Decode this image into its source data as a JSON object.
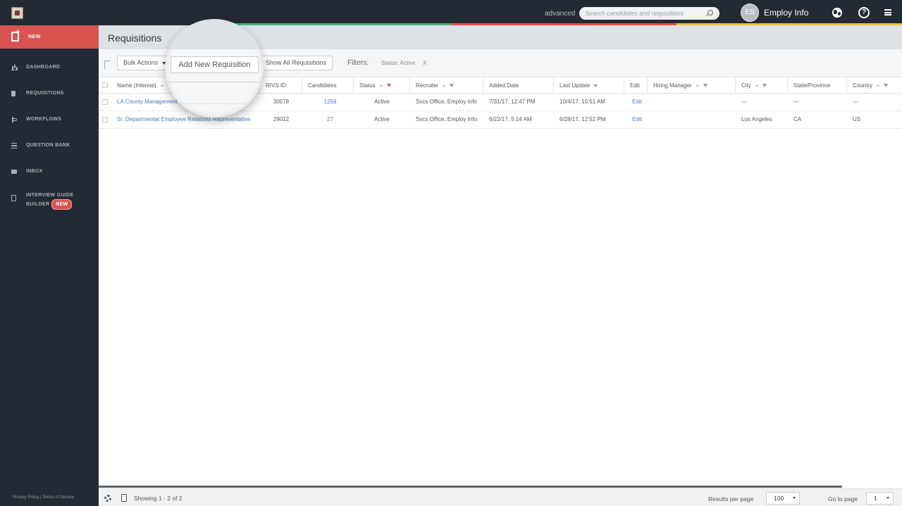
{
  "header": {
    "advanced_label": "advanced",
    "search_placeholder": "Search candidates and requisitions",
    "avatar_initials": "ES",
    "user_name": "Employ Info",
    "help_glyph": "?",
    "icons": [
      "logo-icon",
      "search-icon",
      "globe-icon",
      "help-icon",
      "menu-icon"
    ],
    "colorbar_colors": [
      "#4cae7d",
      "#d9534f",
      "#e2c44a"
    ]
  },
  "sidebar": {
    "new_label": "NEW",
    "items": [
      {
        "label": "DASHBOARD",
        "icon": "bar-chart-icon"
      },
      {
        "label": "REQUISITIONS",
        "icon": "document-icon"
      },
      {
        "label": "WORKFLOWS",
        "icon": "workflow-icon"
      },
      {
        "label": "QUESTION BANK",
        "icon": "list-icon"
      },
      {
        "label": "INBOX",
        "icon": "mail-icon"
      },
      {
        "label": "INTERVIEW GUIDE",
        "label2": "BUILDER",
        "badge": "NEW",
        "icon": "clipboard-icon"
      }
    ],
    "footer": "Privacy Policy | Terms of Service",
    "accent_color": "#d9534f"
  },
  "page": {
    "title": "Requisitions"
  },
  "toolbar": {
    "bulk_actions_label": "Bulk Actions",
    "add_new_label": "Add New Requisition",
    "show_all_label": "Show All Requisitions",
    "filters_label": "Filters:",
    "filter_chip": "Status: Active",
    "filter_remove": "X"
  },
  "table": {
    "columns": [
      "Name (Internal)",
      "RIVS ID",
      "Candidates",
      "Status",
      "Recruiter",
      "Added Date",
      "Last Update",
      "Edit",
      "Hiring Manager",
      "City",
      "State/Province",
      "Country"
    ],
    "rows": [
      {
        "name": "LA County Management",
        "rivs_id": "30578",
        "candidates": "1256",
        "status": "Active",
        "recruiter": "Svcs Office, Employ Info",
        "added": "7/31/17, 12:47 PM",
        "updated": "10/4/17, 10:51 AM",
        "edit": "Edit",
        "hiring_manager": "",
        "city": "---",
        "state": "---",
        "country": "---"
      },
      {
        "name": "Sr. Departmental Employee Relations Representative",
        "rivs_id": "29012",
        "candidates": "27",
        "status": "Active",
        "recruiter": "Svcs Office, Employ Info",
        "added": "6/22/17, 5:14 AM",
        "updated": "6/28/17, 12:52 PM",
        "edit": "Edit",
        "hiring_manager": "",
        "city": "Los Angeles",
        "state": "CA",
        "country": "US"
      }
    ]
  },
  "footer": {
    "showing": "Showing 1 - 2 of 2",
    "results_per_page_label": "Results per page",
    "results_per_page_value": "100",
    "go_to_page_label": "Go to page",
    "go_to_page_value": "1"
  }
}
